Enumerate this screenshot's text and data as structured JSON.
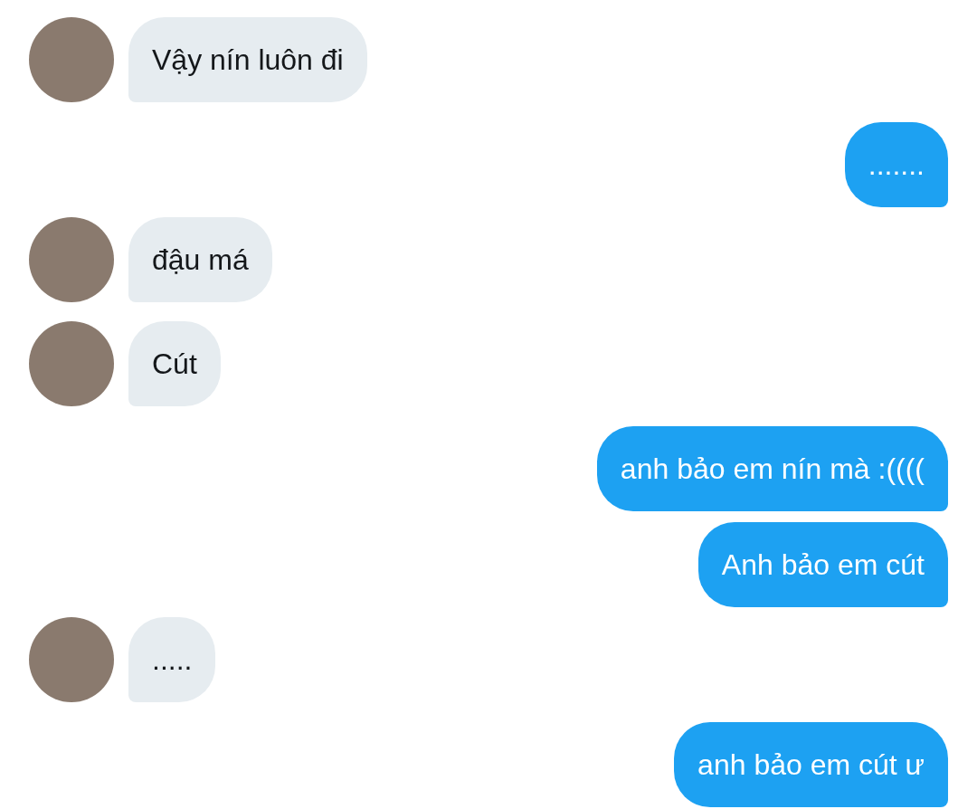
{
  "messages": [
    {
      "kind": "received",
      "text": "Vậy nín luôn đi"
    },
    {
      "kind": "sent",
      "text": "......."
    },
    {
      "kind": "received",
      "text": "đậu má"
    },
    {
      "kind": "received",
      "text": "Cút"
    },
    {
      "kind": "sent",
      "text": "anh bảo em nín mà :(((("
    },
    {
      "kind": "sent",
      "text": "Anh bảo em cút"
    },
    {
      "kind": "received",
      "text": "....."
    },
    {
      "kind": "sent",
      "text": "anh bảo em cút ư"
    }
  ]
}
